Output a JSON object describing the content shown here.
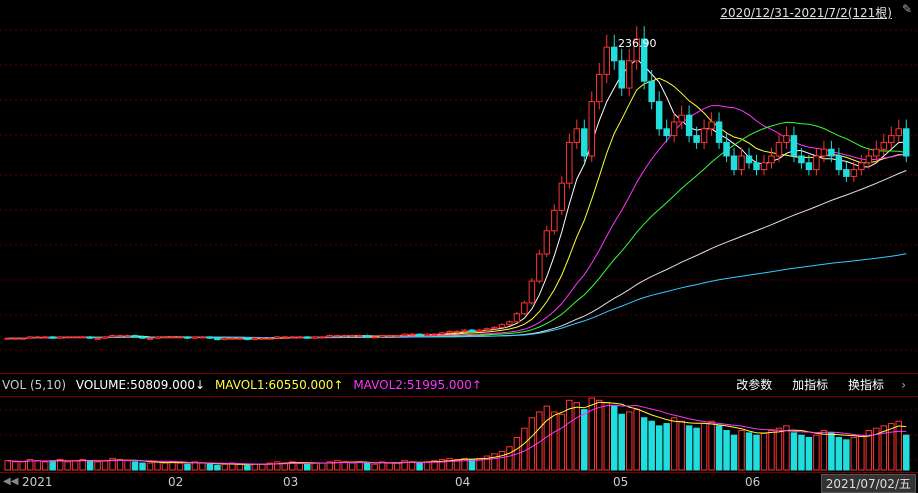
{
  "header": {
    "range": "2020/12/31-2021/7/2(121根)",
    "pin_icon": "pin-icon"
  },
  "price_label": "236.90",
  "volume_bar": {
    "name": "VOL (5,10)",
    "volume": "VOLUME:50809.000↓",
    "mavol1": "MAVOL1:60550.000↑",
    "mavol2": "MAVOL2:51995.000↑",
    "buttons": [
      "改参数",
      "加指标",
      "换指标"
    ],
    "arrow_icon": "chevron-right-icon"
  },
  "x_axis": {
    "nav_icon": "rewind-icon",
    "labels": [
      "2021",
      "02",
      "03",
      "04",
      "05",
      "06"
    ],
    "current_date": "2021/07/02/五"
  },
  "chart_data": {
    "type": "candlestick",
    "n": 121,
    "closes": [
      16,
      16,
      16,
      17,
      17,
      17,
      16,
      17,
      17,
      17,
      17,
      16,
      16,
      17,
      18,
      18,
      18,
      17,
      16,
      16,
      17,
      17,
      17,
      17,
      16,
      17,
      17,
      16,
      15,
      16,
      16,
      16,
      15,
      16,
      16,
      16,
      17,
      17,
      17,
      17,
      16,
      17,
      17,
      18,
      18,
      18,
      18,
      18,
      17,
      17,
      18,
      18,
      18,
      19,
      19,
      18,
      19,
      19,
      20,
      21,
      21,
      22,
      21,
      22,
      23,
      24,
      26,
      28,
      34,
      42,
      58,
      78,
      95,
      110,
      130,
      160,
      170,
      150,
      190,
      210,
      230,
      220,
      200,
      220,
      236,
      205,
      190,
      170,
      165,
      175,
      180,
      165,
      160,
      170,
      175,
      160,
      150,
      140,
      150,
      145,
      140,
      145,
      150,
      160,
      165,
      150,
      145,
      140,
      150,
      155,
      150,
      140,
      135,
      140,
      145,
      150,
      155,
      160,
      165,
      170,
      150
    ],
    "opens": [
      16,
      16,
      16,
      16,
      17,
      17,
      17,
      16,
      17,
      17,
      17,
      17,
      16,
      16,
      17,
      18,
      18,
      18,
      17,
      16,
      16,
      17,
      17,
      17,
      17,
      16,
      17,
      17,
      16,
      15,
      16,
      16,
      16,
      15,
      16,
      16,
      16,
      17,
      17,
      17,
      17,
      16,
      17,
      17,
      18,
      18,
      18,
      18,
      18,
      17,
      17,
      18,
      18,
      18,
      19,
      19,
      18,
      19,
      19,
      20,
      21,
      21,
      22,
      21,
      22,
      23,
      24,
      26,
      28,
      34,
      42,
      58,
      78,
      95,
      110,
      130,
      160,
      170,
      150,
      190,
      210,
      230,
      220,
      200,
      220,
      236,
      205,
      190,
      170,
      165,
      175,
      180,
      165,
      160,
      170,
      175,
      160,
      150,
      140,
      150,
      145,
      140,
      145,
      150,
      160,
      165,
      150,
      145,
      140,
      150,
      155,
      150,
      140,
      135,
      140,
      145,
      150,
      155,
      160,
      165,
      170
    ],
    "volumes": [
      8,
      7,
      7,
      9,
      8,
      7,
      8,
      9,
      7,
      8,
      9,
      8,
      7,
      8,
      10,
      9,
      8,
      7,
      6,
      6,
      7,
      6,
      7,
      6,
      5,
      7,
      6,
      5,
      4,
      5,
      6,
      5,
      4,
      5,
      5,
      6,
      7,
      6,
      7,
      6,
      5,
      6,
      6,
      7,
      8,
      7,
      6,
      7,
      6,
      5,
      7,
      6,
      6,
      8,
      7,
      6,
      7,
      8,
      9,
      10,
      9,
      10,
      9,
      10,
      12,
      14,
      16,
      20,
      28,
      36,
      45,
      50,
      55,
      50,
      48,
      60,
      58,
      52,
      62,
      60,
      58,
      55,
      48,
      50,
      52,
      45,
      42,
      38,
      40,
      45,
      42,
      38,
      36,
      40,
      42,
      38,
      34,
      30,
      34,
      32,
      30,
      32,
      34,
      36,
      38,
      32,
      30,
      28,
      30,
      34,
      32,
      28,
      26,
      28,
      30,
      34,
      36,
      38,
      40,
      42,
      30
    ],
    "price_range": [
      0,
      250
    ],
    "ma_colors": {
      "ma5": "#ffffff",
      "ma10": "#ffff33",
      "ma20": "#ff33ff",
      "ma30": "#33ff33",
      "ma60": "#e0e0e0",
      "ma120": "#33ccff",
      "ma250": "#ffffcc"
    },
    "up_color": "#ff3333",
    "down_color": "#22dddd"
  }
}
